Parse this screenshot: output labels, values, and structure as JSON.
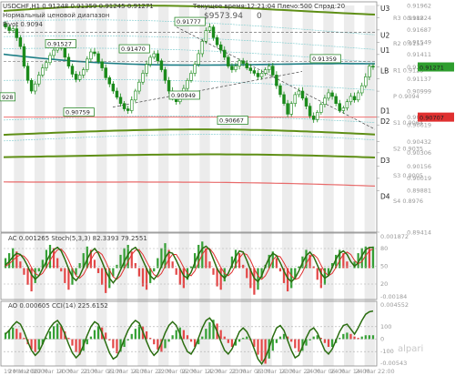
{
  "chart_data": [
    {
      "type": "candlestick",
      "header": {
        "symbol_line": "USDCHF,H1  0.91248 0.91359 0.91245 0.91271",
        "indicator_line": "Нормальный ценовой диапазон",
        "sub_line": "Pivot 0.9094",
        "time_line": "Текущее время:12:21:04 Плечо:500 Спрэд:20",
        "balance_line": "$9573.94",
        "balance_suffix": "0"
      },
      "colors": {
        "bull": "#1a8a1a",
        "bear": "#1a8a1a",
        "lb_line": "#1e7f86",
        "green_band": "#5f8f16",
        "red_band": "#e86a6a",
        "cyan_band": "#8ad1d3",
        "support_line": "#f07070",
        "support_label_bg": "#e03030",
        "price_label_bg": "#2e9e2e"
      },
      "y_range": [
        0.89414,
        0.91962
      ],
      "y_ticks": [
        "0.91962",
        "0.91824",
        "0.91687",
        "0.91549",
        "0.91411",
        "0.91271",
        "0.91137",
        "0.90999",
        "0.90707",
        "0.90619",
        "0.90432",
        "0.90306",
        "0.90156",
        "0.90019",
        "0.89881",
        "0.89414"
      ],
      "tick_values": [
        0.91962,
        0.91824,
        0.91687,
        0.91549,
        0.91411,
        0.91271,
        0.91137,
        0.90999,
        0.90707,
        0.90619,
        0.90432,
        0.90306,
        0.90156,
        0.90019,
        0.89881,
        0.89414
      ],
      "pivot_levels": [
        {
          "name": "R3",
          "value": "0.9182"
        },
        {
          "name": "R2",
          "value": "0.9153"
        },
        {
          "name": "R1",
          "value": "0.9123"
        },
        {
          "name": "P",
          "value": "0.9094"
        },
        {
          "name": "S1",
          "value": "0.9064"
        },
        {
          "name": "S2",
          "value": "0.9035"
        },
        {
          "name": "S3",
          "value": "0.9005"
        },
        {
          "name": "S4",
          "value": "0.8976"
        }
      ],
      "level_labels": [
        {
          "name": "U3",
          "value": 0.9193
        },
        {
          "name": "U2",
          "value": 0.9163
        },
        {
          "name": "U1",
          "value": 0.9146
        },
        {
          "name": "LB",
          "value": 0.9123
        },
        {
          "name": "D1",
          "value": 0.9078
        },
        {
          "name": "D2",
          "value": 0.9066
        },
        {
          "name": "D3",
          "value": 0.9022
        },
        {
          "name": "D4",
          "value": 0.8982
        }
      ],
      "price_boxes": [
        {
          "label": "0.91527",
          "value": 0.91527
        },
        {
          "label": "0.91470",
          "value": 0.9147
        },
        {
          "label": "0.91777",
          "value": 0.91777
        },
        {
          "label": "0.91359",
          "value": 0.91359
        },
        {
          "label": "0.90759",
          "value": 0.90759
        },
        {
          "label": "0.90949",
          "value": 0.90949
        },
        {
          "label": "0.90667",
          "value": 0.90667
        },
        {
          "label": "928",
          "value": 0.9093
        }
      ],
      "current_price": "0.91271",
      "support_price": "0.90707",
      "closes": [
        0.9172,
        0.9168,
        0.917,
        0.916,
        0.915,
        0.9128,
        0.9112,
        0.91,
        0.9108,
        0.9118,
        0.9126,
        0.9132,
        0.914,
        0.9146,
        0.915,
        0.9148,
        0.9138,
        0.9128,
        0.9119,
        0.9113,
        0.9118,
        0.9124,
        0.9136,
        0.9144,
        0.9142,
        0.9133,
        0.9126,
        0.9115,
        0.9108,
        0.91,
        0.9093,
        0.9086,
        0.908,
        0.9078,
        0.909,
        0.91,
        0.911,
        0.912,
        0.913,
        0.9138,
        0.9142,
        0.9134,
        0.9124,
        0.9112,
        0.91,
        0.9092,
        0.9088,
        0.9094,
        0.9103,
        0.9112,
        0.912,
        0.913,
        0.9142,
        0.9156,
        0.9168,
        0.9172,
        0.916,
        0.9152,
        0.9146,
        0.9138,
        0.9128,
        0.9124,
        0.9128,
        0.9134,
        0.9131,
        0.9126,
        0.9123,
        0.912,
        0.9116,
        0.912,
        0.9124,
        0.9128,
        0.9118,
        0.9106,
        0.9096,
        0.9086,
        0.9074,
        0.9086,
        0.9096,
        0.91,
        0.9092,
        0.9083,
        0.9072,
        0.9068,
        0.9076,
        0.9085,
        0.9092,
        0.9098,
        0.9094,
        0.9086,
        0.9078,
        0.9081,
        0.9088,
        0.9094,
        0.909,
        0.9098,
        0.9106,
        0.9116,
        0.9128,
        0.9127
      ],
      "x_labels": [
        "19 Mar 2017",
        "20 Mar 06:00",
        "20 Mar 14:00",
        "20 Mar 22:00",
        "21 Mar 06:00",
        "21 Mar 14:00",
        "21 Mar 22:00",
        "22 Mar 06:00",
        "22 Mar 14:00",
        "22 Mar 22:00",
        "23 Mar 06:00",
        "23 Mar 14:00",
        "23 Mar 22:00",
        "24 Mar 06:00",
        "24 Mar 14:00",
        "24 Mar 22:00"
      ],
      "watermark": "alpari"
    },
    {
      "type": "line",
      "title": "AC  0.001265  Stoch(5,3,3) 82.3393 79.2551",
      "y_ticks": [
        "0.001872",
        "80",
        "50",
        "20",
        "-0.00184"
      ],
      "stoch_levels": [
        80,
        50,
        20
      ],
      "series": [
        {
          "name": "Stoch",
          "values": [
            52,
            58,
            66,
            72,
            70,
            62,
            50,
            36,
            28,
            34,
            46,
            58,
            70,
            78,
            82,
            76,
            62,
            46,
            32,
            26,
            34,
            48,
            62,
            74,
            80,
            72,
            58,
            42,
            30,
            22,
            30,
            44,
            58,
            70,
            78,
            82,
            74,
            60,
            46,
            34,
            28,
            36,
            50,
            64,
            74,
            72,
            60,
            46,
            34,
            30,
            40,
            56,
            70,
            80,
            84,
            78,
            62,
            46,
            36,
            30,
            38,
            52,
            66,
            76,
            74,
            60,
            44,
            30,
            24,
            34,
            50,
            64,
            72,
            68,
            56,
            42,
            30,
            24,
            30,
            42,
            56,
            68,
            74,
            66,
            52,
            38,
            30,
            34,
            48,
            62,
            72,
            76,
            70,
            58,
            50,
            56,
            68,
            78,
            82,
            82
          ]
        },
        {
          "name": "Signal",
          "values": [
            50,
            54,
            60,
            66,
            69,
            67,
            60,
            48,
            38,
            34,
            38,
            48,
            60,
            70,
            78,
            79,
            72,
            60,
            46,
            34,
            30,
            36,
            48,
            61,
            72,
            75,
            70,
            58,
            44,
            32,
            28,
            34,
            46,
            58,
            70,
            77,
            78,
            70,
            58,
            46,
            36,
            32,
            38,
            50,
            62,
            70,
            70,
            60,
            48,
            38,
            34,
            42,
            56,
            70,
            79,
            80,
            72,
            60,
            48,
            38,
            34,
            40,
            52,
            64,
            72,
            70,
            60,
            46,
            34,
            28,
            34,
            46,
            60,
            68,
            66,
            56,
            44,
            34,
            28,
            30,
            40,
            54,
            66,
            70,
            64,
            52,
            40,
            34,
            38,
            48,
            60,
            70,
            74,
            70,
            60,
            54,
            58,
            68,
            76,
            79
          ]
        },
        {
          "name": "AC",
          "values": [
            0.0006,
            0.0009,
            0.0012,
            0.001,
            0.0004,
            -0.0004,
            -0.001,
            -0.0014,
            -0.0009,
            -0.0002,
            0.0005,
            0.0011,
            0.0014,
            0.0012,
            0.0006,
            -0.0002,
            -0.0009,
            -0.0013,
            -0.001,
            -0.0004,
            0.0003,
            0.0009,
            0.0013,
            0.0011,
            0.0005,
            -0.0003,
            -0.001,
            -0.0015,
            -0.0012,
            -0.0005,
            0.0002,
            0.0008,
            0.0012,
            0.0014,
            0.001,
            0.0003,
            -0.0005,
            -0.0011,
            -0.0013,
            -0.0009,
            -0.0002,
            0.0006,
            0.0012,
            0.0015,
            0.0011,
            0.0004,
            -0.0004,
            -0.001,
            -0.0012,
            -0.0007,
            0.0001,
            0.0009,
            0.0014,
            0.0016,
            0.0012,
            0.0004,
            -0.0004,
            -0.0011,
            -0.0013,
            -0.0008,
            0.0,
            0.0007,
            0.0011,
            0.0009,
            0.0002,
            -0.0006,
            -0.0012,
            -0.0016,
            -0.0013,
            -0.0006,
            0.0002,
            0.0008,
            0.001,
            0.0006,
            -0.0002,
            -0.0009,
            -0.0014,
            -0.0012,
            -0.0006,
            0.0001,
            0.0007,
            0.0011,
            0.0008,
            0.0001,
            -0.0007,
            -0.0012,
            -0.001,
            -0.0004,
            0.0003,
            0.0008,
            0.0011,
            0.0009,
            0.0004,
            0.0,
            0.0004,
            0.0009,
            0.0012,
            0.0013,
            0.0012,
            0.0013
          ]
        }
      ]
    },
    {
      "type": "line",
      "title": "AO  0.000605  CCI(14) 225.6152",
      "y_ticks": [
        "0.004552",
        "100",
        "0",
        "-100",
        "-0.00543"
      ],
      "series": [
        {
          "name": "CCI",
          "values": [
            40,
            70,
            110,
            140,
            120,
            60,
            -20,
            -90,
            -130,
            -100,
            -40,
            30,
            90,
            130,
            150,
            110,
            40,
            -40,
            -110,
            -150,
            -120,
            -50,
            30,
            100,
            140,
            120,
            50,
            -30,
            -110,
            -160,
            -140,
            -80,
            0,
            70,
            120,
            150,
            130,
            60,
            -20,
            -90,
            -130,
            -100,
            -30,
            50,
            110,
            140,
            110,
            40,
            -40,
            -100,
            -120,
            -70,
            10,
            90,
            150,
            170,
            130,
            60,
            -20,
            -90,
            -120,
            -80,
            -10,
            60,
            90,
            60,
            0,
            -80,
            -160,
            -200,
            -150,
            -70,
            20,
            90,
            110,
            70,
            -10,
            -90,
            -150,
            -130,
            -60,
            10,
            70,
            90,
            50,
            -20,
            -90,
            -120,
            -80,
            -10,
            60,
            110,
            120,
            80,
            40,
            90,
            150,
            200,
            220,
            226
          ]
        },
        {
          "name": "AO",
          "values": [
            0.001,
            0.0014,
            0.0018,
            0.0016,
            0.001,
            0.0002,
            -0.0008,
            -0.0016,
            -0.002,
            -0.0016,
            -0.0008,
            0.0002,
            0.0012,
            0.002,
            0.0024,
            0.002,
            0.0012,
            0.0002,
            -0.001,
            -0.002,
            -0.0024,
            -0.0018,
            -0.0008,
            0.0004,
            0.0014,
            0.002,
            0.0018,
            0.001,
            -0.0002,
            -0.0014,
            -0.0022,
            -0.002,
            -0.0012,
            -0.0002,
            0.0008,
            0.0016,
            0.0022,
            0.002,
            0.0012,
            0.0002,
            -0.0008,
            -0.0016,
            -0.002,
            -0.0014,
            -0.0004,
            0.0006,
            0.0014,
            0.0018,
            0.0014,
            0.0006,
            -0.0004,
            -0.0012,
            -0.0008,
            0.0004,
            0.0016,
            0.0026,
            0.003,
            0.0024,
            0.0014,
            0.0004,
            -0.0006,
            -0.0012,
            -0.001,
            -0.0004,
            0.0002,
            0.0004,
            -0.0002,
            -0.0012,
            -0.0024,
            -0.0034,
            -0.0038,
            -0.003,
            -0.0018,
            -0.0006,
            0.0004,
            0.0008,
            0.0004,
            -0.0004,
            -0.0014,
            -0.002,
            -0.0018,
            -0.001,
            -0.0002,
            0.0004,
            0.0006,
            0.0002,
            -0.0006,
            -0.0012,
            -0.0012,
            -0.0006,
            0.0002,
            0.0008,
            0.001,
            0.0008,
            0.0004,
            0.0002,
            0.0004,
            0.0006,
            0.0006,
            0.0006
          ]
        }
      ]
    }
  ]
}
